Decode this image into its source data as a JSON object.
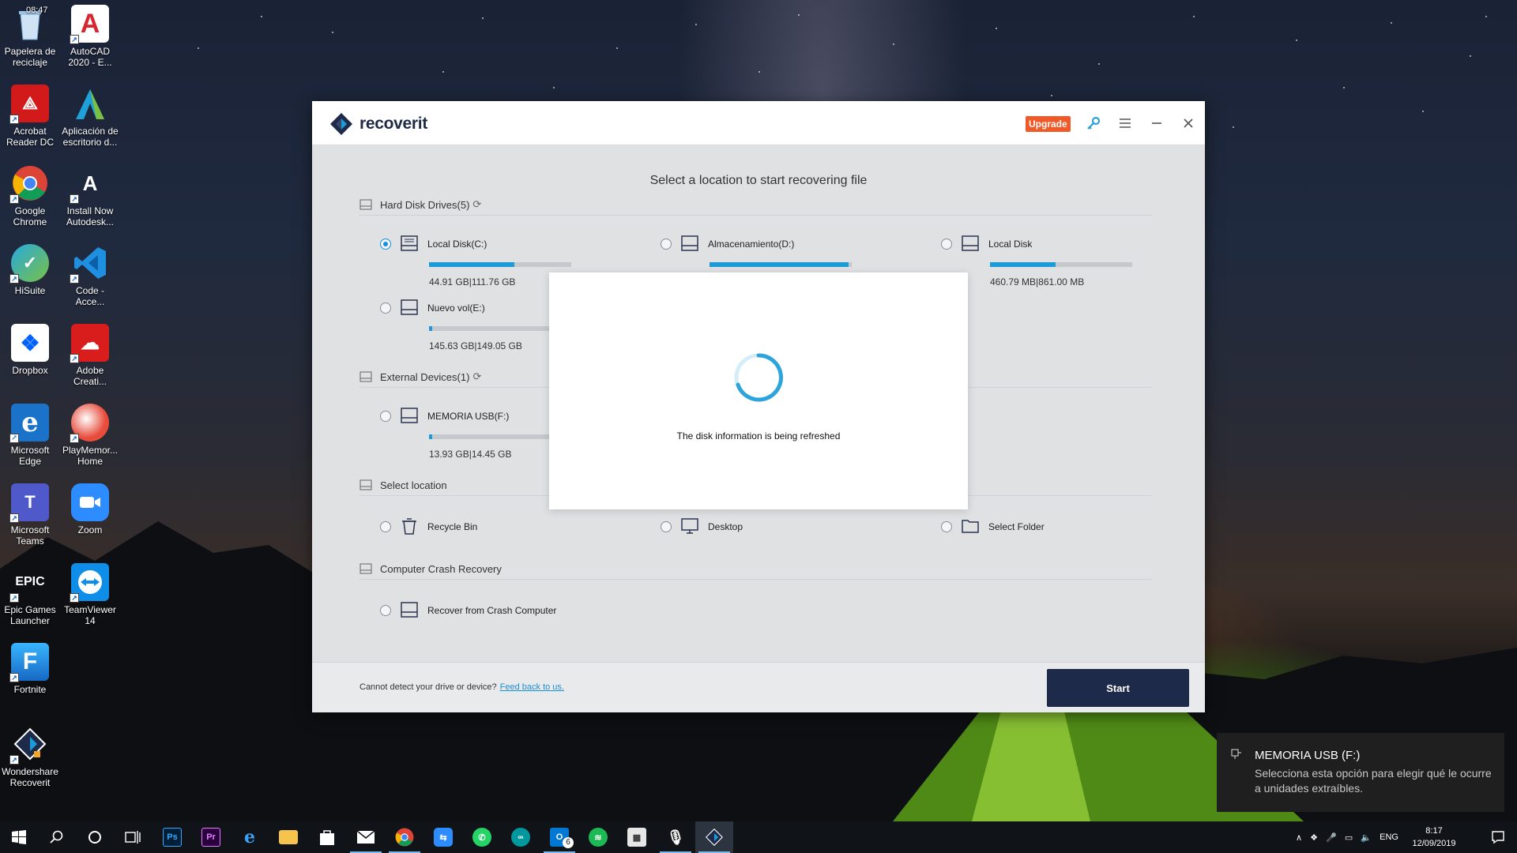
{
  "desktop": {
    "icons": [
      {
        "label": "Papelera de\nreciclaje",
        "icon": "recycle-bin-icon",
        "color": "#6fa7d8"
      },
      {
        "label": "AutoCAD\n2020 - E...",
        "icon": "autocad-icon",
        "color": "#d8262e"
      },
      {
        "label": "Acrobat\nReader DC",
        "icon": "acrobat-icon",
        "color": "#d21a1a"
      },
      {
        "label": "Aplicación de\nescritorio d...",
        "icon": "autodesk-app-icon",
        "color": "#2a8ac8"
      },
      {
        "label": "Google\nChrome",
        "icon": "chrome-icon",
        "color": "#e8453c"
      },
      {
        "label": "Install Now\nAutodesk...",
        "icon": "autodesk-install-icon",
        "color": "#444444"
      },
      {
        "label": "HiSuite",
        "icon": "hisuite-icon",
        "color": "#27a9e0"
      },
      {
        "label": "Code -\nAcce...",
        "icon": "vscode-icon",
        "color": "#1f8fe0"
      },
      {
        "label": "Dropbox",
        "icon": "dropbox-icon",
        "color": "#0061fe"
      },
      {
        "label": "Adobe\nCreati...",
        "icon": "creative-cloud-icon",
        "color": "#d91c1c"
      },
      {
        "label": "Microsoft\nEdge",
        "icon": "edge-icon",
        "color": "#1a73c9"
      },
      {
        "label": "PlayMemor...\nHome",
        "icon": "playmemories-icon",
        "color": "#c0392b"
      },
      {
        "label": "Microsoft\nTeams",
        "icon": "teams-icon",
        "color": "#5059c9"
      },
      {
        "label": "Zoom",
        "icon": "zoom-icon",
        "color": "#2d8cff"
      },
      {
        "label": "Epic Games\nLauncher",
        "icon": "epic-games-icon",
        "color": "#222222"
      },
      {
        "label": "TeamViewer\n14",
        "icon": "teamviewer-icon",
        "color": "#0e8ee9"
      },
      {
        "label": "Fortnite",
        "icon": "fortnite-icon",
        "color": "#2b9ae8"
      },
      {
        "label": "Wondershare\nRecoverit",
        "icon": "recoverit-icon",
        "color": "#1e2a4a"
      }
    ],
    "corner_time": "08:47"
  },
  "app": {
    "logo_text": "recoverit",
    "upgrade_label": "Upgrade",
    "main_title": "Select a location to start recovering file",
    "sections": {
      "hdd": "Hard Disk Drives(5)",
      "external": "External Devices(1)",
      "location": "Select location",
      "crash": "Computer Crash Recovery"
    },
    "drives": [
      {
        "name": "Local Disk(C:)",
        "size": "44.91  GB|111.76  GB",
        "fill": 0.6,
        "checked": true
      },
      {
        "name": "Almacenamiento(D:)",
        "size": "",
        "fill": 0.98,
        "checked": false
      },
      {
        "name": "Local Disk",
        "size": "460.79  MB|861.00  MB",
        "fill": 0.46,
        "checked": false
      },
      {
        "name": "Nuevo vol(E:)",
        "size": "145.63  GB|149.05  GB",
        "fill": 0.02,
        "checked": false
      }
    ],
    "external": [
      {
        "name": "MEMORIA USB(F:)",
        "size": "13.93  GB|14.45  GB",
        "fill": 0.02,
        "checked": false
      }
    ],
    "locations": [
      "Recycle Bin",
      "Desktop",
      "Select Folder"
    ],
    "crash_item": "Recover from Crash Computer",
    "footer_text": "Cannot detect your drive or device?",
    "footer_link": "Feed back to us.",
    "start_label": "Start",
    "modal_text": "The disk information is being refreshed",
    "accent": "#1b9bd7"
  },
  "notification": {
    "title": "MEMORIA USB (F:)",
    "body": "Selecciona esta opción para elegir qué le ocurre a unidades extraíbles."
  },
  "taskbar": {
    "apps": [
      "start-icon",
      "search-icon",
      "cortana-icon",
      "task-view-icon",
      "photoshop-icon",
      "premiere-icon",
      "edge-icon",
      "file-explorer-icon",
      "store-icon",
      "mail-icon",
      "chrome-icon",
      "remote-icon",
      "whatsapp-icon",
      "arduino-icon",
      "outlook-icon",
      "spotify-icon",
      "calculator-icon",
      "mic-app-icon",
      "recoverit-icon"
    ],
    "outlook_badge": "6",
    "language": "ENG",
    "time": "8:17",
    "date": "12/09/2019"
  }
}
